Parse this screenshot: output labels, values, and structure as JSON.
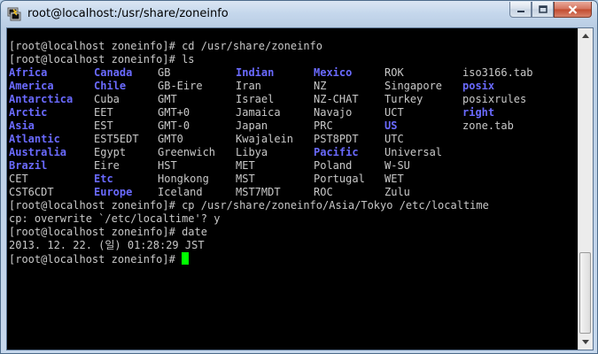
{
  "window": {
    "title": "root@localhost:/usr/share/zoneinfo",
    "colors": {
      "terminal_bg": "#000000",
      "text": "#c8c8c8",
      "dir": "#6a6aff",
      "cursor": "#00ff00"
    }
  },
  "terminal": {
    "lines_before": [
      "[root@localhost zoneinfo]# cd /usr/share/zoneinfo",
      "[root@localhost zoneinfo]# ls"
    ],
    "ls_rows": [
      [
        {
          "t": "Africa",
          "d": true
        },
        {
          "t": "Canada",
          "d": true
        },
        {
          "t": "GB",
          "d": false
        },
        {
          "t": "Indian",
          "d": true
        },
        {
          "t": "Mexico",
          "d": true
        },
        {
          "t": "ROK",
          "d": false
        },
        {
          "t": "iso3166.tab",
          "d": false
        }
      ],
      [
        {
          "t": "America",
          "d": true
        },
        {
          "t": "Chile",
          "d": true
        },
        {
          "t": "GB-Eire",
          "d": false
        },
        {
          "t": "Iran",
          "d": false
        },
        {
          "t": "NZ",
          "d": false
        },
        {
          "t": "Singapore",
          "d": false
        },
        {
          "t": "posix",
          "d": true
        }
      ],
      [
        {
          "t": "Antarctica",
          "d": true
        },
        {
          "t": "Cuba",
          "d": false
        },
        {
          "t": "GMT",
          "d": false
        },
        {
          "t": "Israel",
          "d": false
        },
        {
          "t": "NZ-CHAT",
          "d": false
        },
        {
          "t": "Turkey",
          "d": false
        },
        {
          "t": "posixrules",
          "d": false
        }
      ],
      [
        {
          "t": "Arctic",
          "d": true
        },
        {
          "t": "EET",
          "d": false
        },
        {
          "t": "GMT+0",
          "d": false
        },
        {
          "t": "Jamaica",
          "d": false
        },
        {
          "t": "Navajo",
          "d": false
        },
        {
          "t": "UCT",
          "d": false
        },
        {
          "t": "right",
          "d": true
        }
      ],
      [
        {
          "t": "Asia",
          "d": true
        },
        {
          "t": "EST",
          "d": false
        },
        {
          "t": "GMT-0",
          "d": false
        },
        {
          "t": "Japan",
          "d": false
        },
        {
          "t": "PRC",
          "d": false
        },
        {
          "t": "US",
          "d": true
        },
        {
          "t": "zone.tab",
          "d": false
        }
      ],
      [
        {
          "t": "Atlantic",
          "d": true
        },
        {
          "t": "EST5EDT",
          "d": false
        },
        {
          "t": "GMT0",
          "d": false
        },
        {
          "t": "Kwajalein",
          "d": false
        },
        {
          "t": "PST8PDT",
          "d": false
        },
        {
          "t": "UTC",
          "d": false
        },
        {
          "t": "",
          "d": false
        }
      ],
      [
        {
          "t": "Australia",
          "d": true
        },
        {
          "t": "Egypt",
          "d": false
        },
        {
          "t": "Greenwich",
          "d": false
        },
        {
          "t": "Libya",
          "d": false
        },
        {
          "t": "Pacific",
          "d": true
        },
        {
          "t": "Universal",
          "d": false
        },
        {
          "t": "",
          "d": false
        }
      ],
      [
        {
          "t": "Brazil",
          "d": true
        },
        {
          "t": "Eire",
          "d": false
        },
        {
          "t": "HST",
          "d": false
        },
        {
          "t": "MET",
          "d": false
        },
        {
          "t": "Poland",
          "d": false
        },
        {
          "t": "W-SU",
          "d": false
        },
        {
          "t": "",
          "d": false
        }
      ],
      [
        {
          "t": "CET",
          "d": false
        },
        {
          "t": "Etc",
          "d": true
        },
        {
          "t": "Hongkong",
          "d": false
        },
        {
          "t": "MST",
          "d": false
        },
        {
          "t": "Portugal",
          "d": false
        },
        {
          "t": "WET",
          "d": false
        },
        {
          "t": "",
          "d": false
        }
      ],
      [
        {
          "t": "CST6CDT",
          "d": false
        },
        {
          "t": "Europe",
          "d": true
        },
        {
          "t": "Iceland",
          "d": false
        },
        {
          "t": "MST7MDT",
          "d": false
        },
        {
          "t": "ROC",
          "d": false
        },
        {
          "t": "Zulu",
          "d": false
        },
        {
          "t": "",
          "d": false
        }
      ]
    ],
    "lines_after": [
      "[root@localhost zoneinfo]# cp /usr/share/zoneinfo/Asia/Tokyo /etc/localtime",
      "cp: overwrite `/etc/localtime'? y",
      "[root@localhost zoneinfo]# date",
      "2013. 12. 22. (일) 01:28:29 JST"
    ],
    "prompt": "[root@localhost zoneinfo]# "
  }
}
